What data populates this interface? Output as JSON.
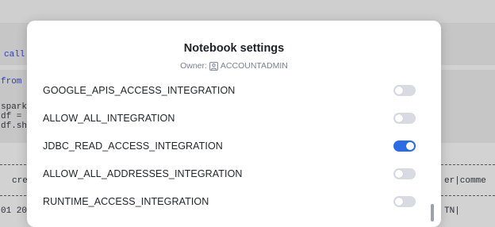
{
  "background": {
    "code_lines": [
      {
        "text": "call"
      },
      {
        "text": "from"
      },
      {
        "text": "spark"
      },
      {
        "text": "df ="
      },
      {
        "text": "df.sh"
      }
    ],
    "table_header_left": "cre",
    "table_header_right": "er|comme",
    "table_row_left": "01 20",
    "table_row_right": "TN|"
  },
  "modal": {
    "title": "Notebook settings",
    "owner_label": "Owner:",
    "owner_name": "ACCOUNTADMIN",
    "owner_icon": "user-badge-icon",
    "settings": [
      {
        "name": "GOOGLE_APIS_ACCESS_INTEGRATION",
        "enabled": false
      },
      {
        "name": "ALLOW_ALL_INTEGRATION",
        "enabled": false
      },
      {
        "name": "JDBC_READ_ACCESS_INTEGRATION",
        "enabled": true
      },
      {
        "name": "ALLOW_ALL_ADDRESSES_INTEGRATION",
        "enabled": false
      },
      {
        "name": "RUNTIME_ACCESS_INTEGRATION",
        "enabled": false
      }
    ]
  },
  "colors": {
    "toggle_on": "#2d6be4",
    "toggle_off": "#d8dbe2"
  }
}
